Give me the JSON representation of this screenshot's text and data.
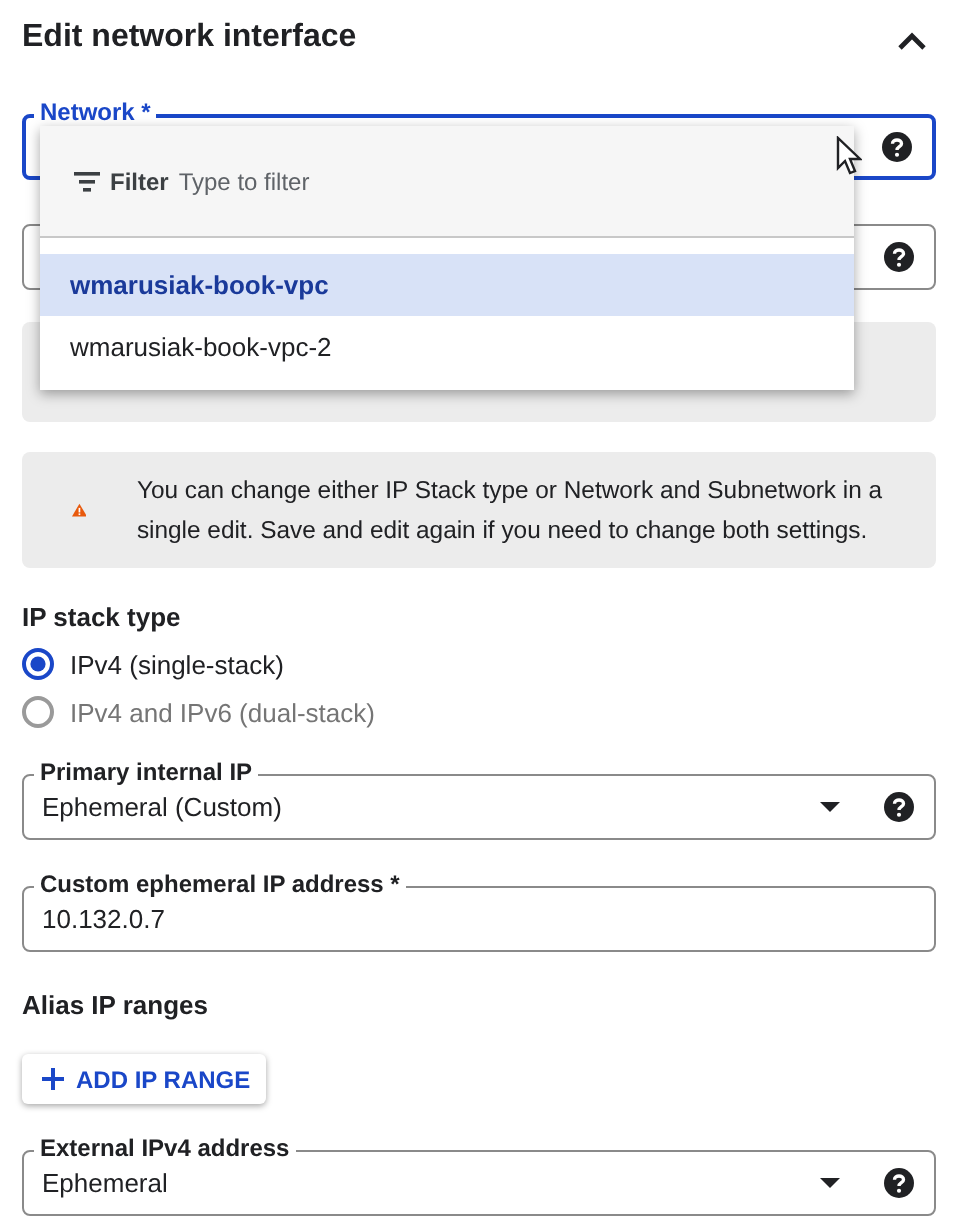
{
  "header": {
    "title": "Edit network interface",
    "expanded": true
  },
  "network_field": {
    "label": "Network *",
    "focused": true,
    "dropdown": {
      "open": true,
      "filter_label": "Filter",
      "placeholder": "Type to filter",
      "options": [
        {
          "label": "wmarusiak-book-vpc",
          "selected": true
        },
        {
          "label": "wmarusiak-book-vpc-2",
          "selected": false
        }
      ]
    }
  },
  "subnetwork_field": {
    "focused": false
  },
  "warning": {
    "text": "You can change either IP Stack type or Network and Subnetwork in a single edit. Save and edit again if you need to change both settings."
  },
  "form": [
    {
      "kind": "radio_group",
      "title": "IP stack type",
      "options": [
        {
          "label": "IPv4 (single-stack)",
          "selected": true,
          "disabled": false
        },
        {
          "label": "IPv4 and IPv6 (dual-stack)",
          "selected": false,
          "disabled": true
        }
      ]
    },
    {
      "kind": "select",
      "label": "Primary internal IP",
      "value": "Ephemeral (Custom)"
    },
    {
      "kind": "text",
      "label": "Custom ephemeral IP address *",
      "value": "10.132.0.7"
    },
    {
      "kind": "heading",
      "title": "Alias IP ranges"
    },
    {
      "kind": "button",
      "label": "ADD IP RANGE"
    },
    {
      "kind": "select",
      "label": "External IPv4 address",
      "value": "Ephemeral"
    }
  ]
}
